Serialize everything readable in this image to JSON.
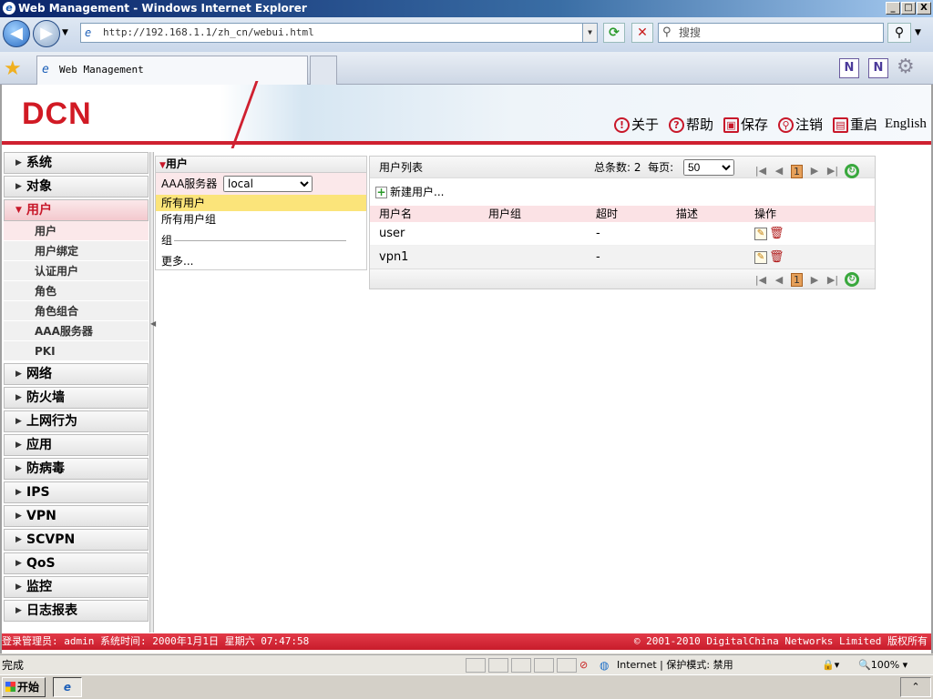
{
  "window": {
    "title": "Web Management - Windows Internet Explorer",
    "min_label": "_",
    "max_label": "□",
    "close_label": "X"
  },
  "browser": {
    "address": "http://192.168.1.1/zh_cn/webui.html",
    "search_placeholder": "搜搜",
    "tab_title": "Web Management"
  },
  "banner": {
    "logo_text": "DCN",
    "links": [
      {
        "label": "关于",
        "icon": "!"
      },
      {
        "label": "帮助",
        "icon": "?"
      },
      {
        "label": "保存",
        "icon": "▣"
      },
      {
        "label": "注销",
        "icon": "⚲"
      },
      {
        "label": "重启",
        "icon": "▤"
      }
    ],
    "language": "English"
  },
  "sidebar": {
    "items_before": [
      "系统",
      "对象"
    ],
    "open_item": "用户",
    "subitems": [
      "用户",
      "用户绑定",
      "认证用户",
      "角色",
      "角色组合",
      "AAA服务器",
      "PKI"
    ],
    "items_after": [
      "网络",
      "防火墙",
      "上网行为",
      "应用",
      "防病毒",
      "IPS",
      "VPN",
      "SCVPN",
      "QoS",
      "监控",
      "日志报表"
    ]
  },
  "middle": {
    "header": "用户",
    "aaa_label": "AAA服务器",
    "aaa_value": "local",
    "items": [
      "所有用户",
      "所有用户组"
    ],
    "group_label": "组",
    "more": "更多..."
  },
  "userlist": {
    "title": "用户列表",
    "total_label": "总条数: 2",
    "perpage_label": "每页:",
    "perpage_value": "50",
    "page": "1",
    "new_user": "新建用户...",
    "columns": [
      "用户名",
      "用户组",
      "超时",
      "描述",
      "操作"
    ],
    "rows": [
      {
        "name": "user",
        "group": "",
        "timeout": "-",
        "desc": ""
      },
      {
        "name": "vpn1",
        "group": "",
        "timeout": "-",
        "desc": ""
      }
    ]
  },
  "footer": {
    "login_info": "登录管理员: admin 系统时间: 2000年1月1日 星期六 07:47:58",
    "copyright": "© 2001-2010 DigitalChina Networks Limited 版权所有"
  },
  "ie_status": {
    "done": "完成",
    "zone": "Internet | 保护模式: 禁用",
    "zoom": "100%"
  },
  "taskbar": {
    "start": "开始"
  }
}
